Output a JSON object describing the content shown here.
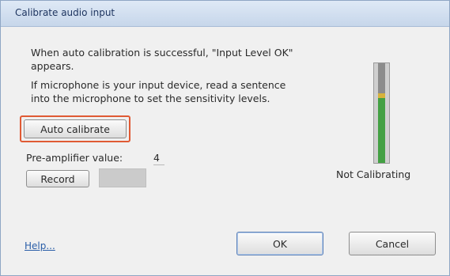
{
  "window": {
    "title": "Calibrate audio input"
  },
  "instructions": {
    "line1": "When auto calibration is successful, \"Input Level OK\"",
    "line2": "appears.",
    "line3": "If microphone is your input device, read a sentence",
    "line4": "into the microphone to set the sensitivity levels."
  },
  "buttons": {
    "auto_calibrate": "Auto calibrate",
    "record": "Record",
    "ok": "OK",
    "cancel": "Cancel"
  },
  "preamp": {
    "label": "Pre-amplifier value:",
    "value": "4"
  },
  "status": {
    "text": "Not Calibrating"
  },
  "help": {
    "label": "Help..."
  },
  "colors": {
    "highlight": "#e05a34",
    "meter_level": "#43a043",
    "meter_marker": "#d7b23b"
  }
}
